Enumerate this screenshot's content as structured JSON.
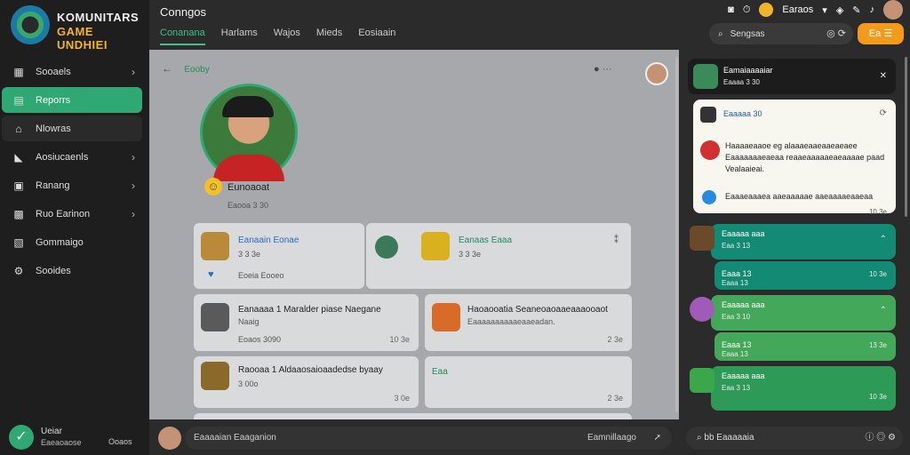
{
  "brand": {
    "line1": "KOMUNITARS",
    "line2": "GAME UNDHIEI"
  },
  "sidebar": {
    "items": [
      {
        "label": "Sooaels",
        "icon": "library-icon",
        "chevron": "›"
      },
      {
        "label": "Reporrs",
        "icon": "reports-icon",
        "chevron": ""
      },
      {
        "label": "Nlowras",
        "icon": "home-icon",
        "chevron": ""
      },
      {
        "label": "Aosiucaenls",
        "icon": "tag-icon",
        "chevron": "›"
      },
      {
        "label": "Ranang",
        "icon": "ranking-icon",
        "chevron": "›"
      },
      {
        "label": "Ruo Earinon",
        "icon": "calendar-icon",
        "chevron": "›"
      },
      {
        "label": "Gommaigo",
        "icon": "gamepad-icon",
        "chevron": ""
      },
      {
        "label": "Sooides",
        "icon": "settings-icon",
        "chevron": ""
      }
    ],
    "footer": {
      "name": "Ueiar",
      "sub": "Eaeaoaose",
      "right": "Ooaos"
    }
  },
  "topbar": {
    "title": "Conngos",
    "tabs": [
      "Conanana",
      "Harlams",
      "Wajos",
      "Mieds",
      "Eosiaain"
    ],
    "active_tab": 0,
    "user_label": "Earaos",
    "search_placeholder": "Sengsas",
    "action_label": "Ea"
  },
  "main": {
    "back_label": "Eooby",
    "profile_name": "Eunoaoat",
    "profile_sub": "Eaooa 3 30",
    "cards": [
      {
        "title": "Eanaain Eonae",
        "meta": "3 3 3e",
        "sub": "Eoeia Eooeo",
        "time": ""
      },
      {
        "title": "Eanaas Eaaa",
        "meta": "3 3 3e",
        "sub": "",
        "time": ""
      },
      {
        "title": "Eanaaaa 1 Maralder piase Naegane",
        "meta": "Naaig",
        "sub": "Eoaos 3090",
        "time": "10 3e"
      },
      {
        "title": "Haoaooatia Seaneoaoaaeaaaooaot",
        "meta": "Eaaaaaaaaaaeaaeadan.",
        "sub": "",
        "time": "2 3e"
      },
      {
        "title": "Raooaa 1 Aldaaosaioaadedse byaay",
        "meta": "3 00o",
        "sub": "",
        "time": "3 0e"
      },
      {
        "title": "Eaa",
        "meta": "",
        "sub": "",
        "time": "2 3e"
      }
    ]
  },
  "compose": {
    "placeholder": "Eaaaaian Eaaganion",
    "right_label": "Eamnillaago"
  },
  "feed": {
    "header": {
      "title": "Eamaiaaaaiar",
      "meta": "Eaaaa 3 30"
    },
    "popup": {
      "title": "Eaaaaa 30",
      "msg": "Haaaaeaaoe eg alaaaeaaeaaeaeaee Eaaaaaaaeaeaa reaaeaaaaaeaeaaaae paad Vealaaieai.",
      "msg2": "Eaaaeaaaea aaeaaaaae aaeaaaaeaaeaa",
      "foot": "10 3e"
    },
    "items": [
      {
        "title": "Eaaaaa aaa",
        "meta": "Eaa 3 13",
        "time": ""
      },
      {
        "title": "Eaaa 13",
        "meta": "Eaaa 13",
        "time": "10 3e"
      },
      {
        "title": "Eaaaaa aaa",
        "meta": "Eaa 3 10",
        "time": ""
      },
      {
        "title": "Eaaa 13",
        "meta": "Eaaa 13",
        "time": "13 3e"
      },
      {
        "title": "Eaaaaa aaa",
        "meta": "Eaa 3 13",
        "time": "10 3e"
      }
    ],
    "search_placeholder": "bb Eaaaaaia"
  },
  "colors": {
    "accent": "#2fa873",
    "orange": "#f39a1a",
    "teal": "#138a73",
    "green": "#43a85a"
  }
}
